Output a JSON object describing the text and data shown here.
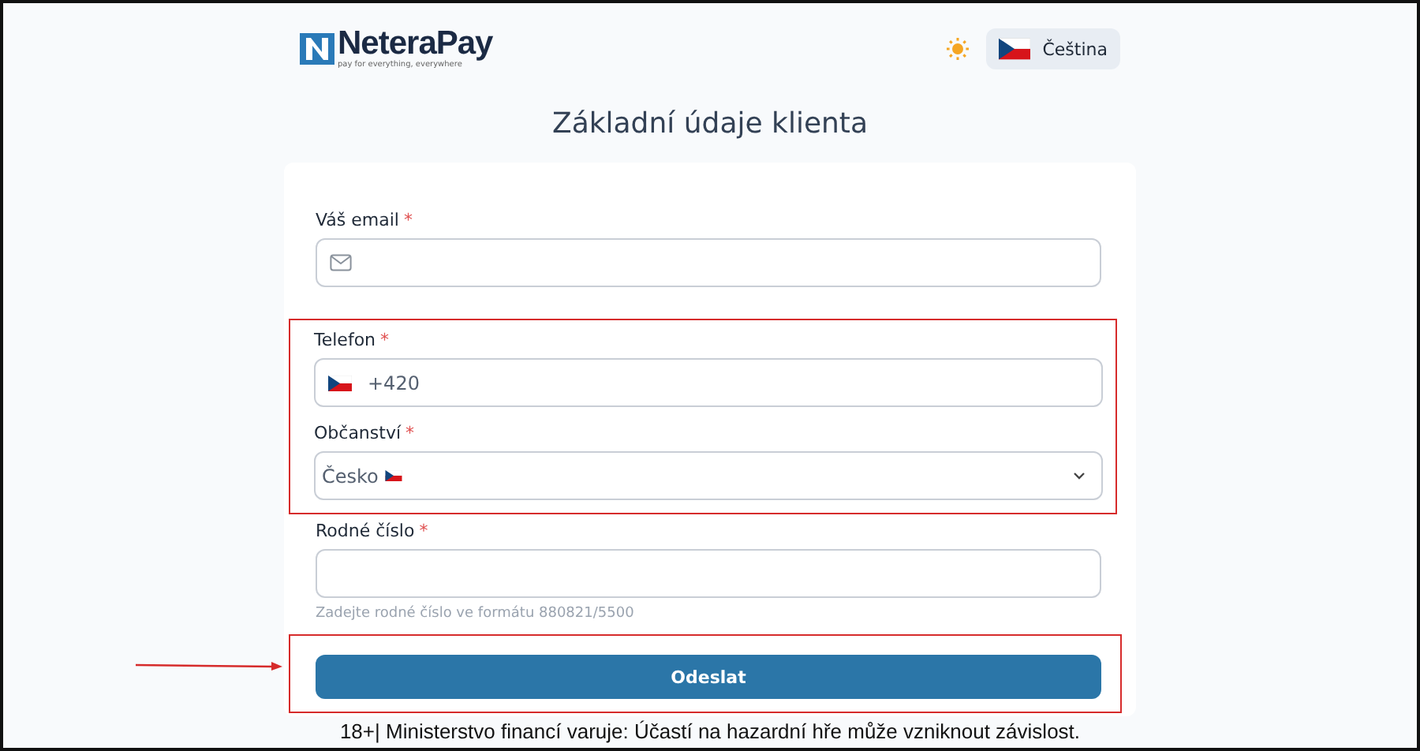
{
  "header": {
    "logo": {
      "name": "NeteraPay",
      "tagline": "pay for everything, everywhere"
    },
    "language": "Čeština"
  },
  "title": "Základní údaje klienta",
  "sections": [
    {
      "highlighted": false,
      "fields": [
        {
          "kind": "email",
          "label": "Váš email",
          "asterisk": "*"
        }
      ]
    },
    {
      "highlighted": true,
      "fields": [
        {
          "kind": "phone",
          "label": "Telefon",
          "asterisk": "*",
          "value": "+420"
        },
        {
          "kind": "select",
          "label": "Občanství",
          "asterisk": "*",
          "value": "Česko"
        }
      ]
    },
    {
      "highlighted": false,
      "fields": [
        {
          "kind": "text",
          "label": "Rodné číslo",
          "asterisk": "*",
          "hint": "Zadejte rodné číslo ve formátu 880821/5500"
        }
      ]
    }
  ],
  "submit": {
    "label": "Odeslat",
    "highlighted": true,
    "arrow": true
  },
  "footer": "18+| Ministerstvo financí varuje: Účastí na hazardní hře může vzniknout závislost."
}
